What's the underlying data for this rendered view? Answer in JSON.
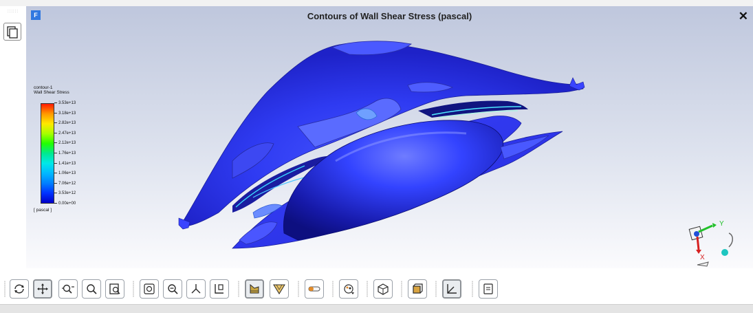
{
  "app": {
    "logo_letter": "F"
  },
  "viewport": {
    "title": "Contours of Wall Shear Stress (pascal)",
    "close_glyph": "✕"
  },
  "legend": {
    "object_name": "contour-1",
    "field_name": "Wall Shear Stress",
    "ticks": [
      "3.53e+13",
      "3.18e+13",
      "2.82e+13",
      "2.47e+13",
      "2.12e+13",
      "1.76e+13",
      "1.41e+13",
      "1.06e+13",
      "7.06e+12",
      "3.53e+12",
      "0.00e+00"
    ],
    "unit": "[ pascal ]",
    "colors": [
      "#ff1a00",
      "#ff9800",
      "#ffe800",
      "#a8ff00",
      "#22ff00",
      "#00e890",
      "#00e8e8",
      "#00b8ff",
      "#0080ff",
      "#0033ff",
      "#0000c8"
    ]
  },
  "axes": {
    "x_label": "X",
    "y_label": "Y",
    "x_color": "#d62020",
    "y_color": "#22c02a"
  },
  "toolbar": {
    "buttons": [
      {
        "name": "rotate-view-icon",
        "active": false
      },
      {
        "name": "pan-icon",
        "active": true
      },
      {
        "name": "zoom-in-out-icon",
        "active": false
      },
      {
        "name": "zoom-to-area-icon",
        "active": false
      },
      {
        "name": "zoom-to-fit-icon",
        "active": false
      },
      {
        "name": "fit-to-window-icon",
        "active": false
      },
      {
        "name": "zoom-previous-icon",
        "active": false
      },
      {
        "name": "isometric-view-icon",
        "active": false
      },
      {
        "name": "view-orientation-icon",
        "active": false
      },
      {
        "name": "lighting-icon",
        "active": true
      },
      {
        "name": "mesh-display-icon",
        "active": false
      },
      {
        "name": "transparency-slider-icon",
        "active": false
      },
      {
        "name": "colormap-options-icon",
        "active": false
      },
      {
        "name": "scene-objects-icon",
        "active": false
      },
      {
        "name": "bounding-box-icon",
        "active": false
      },
      {
        "name": "axes-triad-icon",
        "active": true
      },
      {
        "name": "annotation-icon",
        "active": false
      }
    ]
  }
}
